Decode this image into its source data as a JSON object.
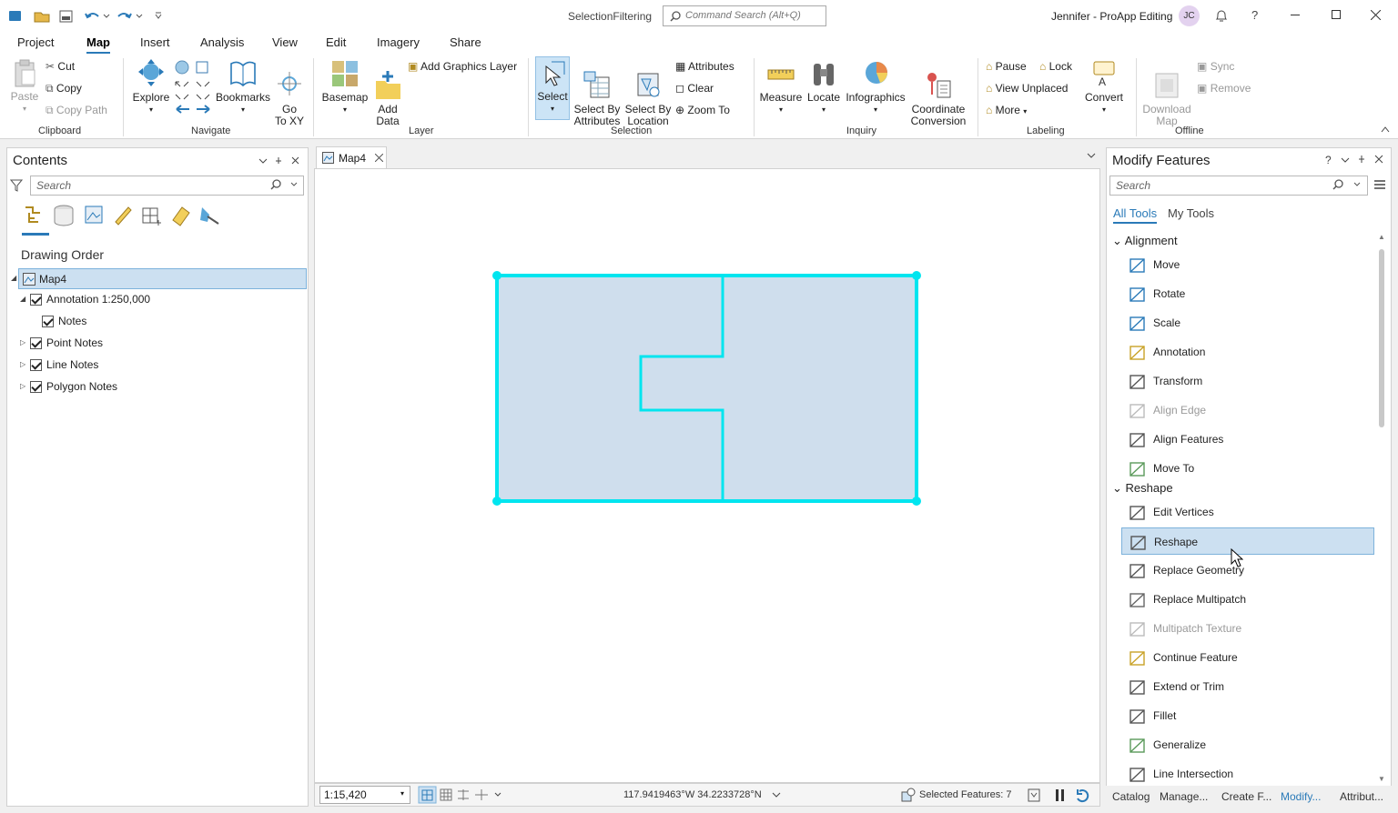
{
  "app": {
    "document_title": "SelectionFiltering",
    "user": "Jennifer - ProApp Editing",
    "avatar_initials": "JC",
    "command_search_placeholder": "Command Search (Alt+Q)"
  },
  "ribbon_tabs": [
    "Project",
    "Map",
    "Insert",
    "Analysis",
    "View",
    "Edit",
    "Imagery",
    "Share"
  ],
  "active_tab": "Map",
  "ribbon": {
    "clipboard": {
      "group": "Clipboard",
      "paste": "Paste",
      "cut": "Cut",
      "copy": "Copy",
      "copy_path": "Copy Path"
    },
    "navigate": {
      "group": "Navigate",
      "explore": "Explore",
      "bookmarks": "Bookmarks",
      "go_to_xy": "Go\nTo XY"
    },
    "layer": {
      "group": "Layer",
      "basemap": "Basemap",
      "add_data": "Add\nData",
      "add_graphics_layer": "Add Graphics Layer"
    },
    "selection": {
      "group": "Selection",
      "select": "Select",
      "select_by_attributes": "Select By\nAttributes",
      "select_by_location": "Select By\nLocation",
      "attributes": "Attributes",
      "clear": "Clear",
      "zoom_to": "Zoom To"
    },
    "inquiry": {
      "group": "Inquiry",
      "measure": "Measure",
      "locate": "Locate",
      "infographics": "Infographics",
      "coordinate_conversion": "Coordinate\nConversion"
    },
    "labeling": {
      "group": "Labeling",
      "pause": "Pause",
      "lock": "Lock",
      "view_unplaced": "View Unplaced",
      "more": "More",
      "convert": "Convert"
    },
    "offline": {
      "group": "Offline",
      "download_map": "Download\nMap",
      "sync": "Sync",
      "remove": "Remove"
    }
  },
  "contents": {
    "title": "Contents",
    "search_placeholder": "Search",
    "drawing_order": "Drawing Order",
    "map_name": "Map4",
    "layers": [
      {
        "label": "Annotation 1:250,000",
        "indent": 0,
        "expanded": true
      },
      {
        "label": "Notes",
        "indent": 1
      },
      {
        "label": "Point Notes",
        "indent": 0
      },
      {
        "label": "Line Notes",
        "indent": 0
      },
      {
        "label": "Polygon Notes",
        "indent": 0
      }
    ]
  },
  "map_view": {
    "tab_label": "Map4",
    "scale": "1:15,420",
    "coordinates": "117.9419463°W 34.2233728°N",
    "selected_features": "Selected Features: 7"
  },
  "modify": {
    "title": "Modify Features",
    "search_placeholder": "Search",
    "tabs": [
      "All Tools",
      "My Tools"
    ],
    "sections": [
      {
        "name": "Alignment",
        "tools": [
          {
            "label": "Move"
          },
          {
            "label": "Rotate"
          },
          {
            "label": "Scale"
          },
          {
            "label": "Annotation"
          },
          {
            "label": "Transform"
          },
          {
            "label": "Align Edge",
            "disabled": true
          },
          {
            "label": "Align Features"
          },
          {
            "label": "Move To"
          }
        ]
      },
      {
        "name": "Reshape",
        "tools": [
          {
            "label": "Edit Vertices"
          },
          {
            "label": "Reshape",
            "selected": true
          },
          {
            "label": "Replace Geometry"
          },
          {
            "label": "Replace Multipatch"
          },
          {
            "label": "Multipatch Texture",
            "disabled": true
          },
          {
            "label": "Continue Feature"
          },
          {
            "label": "Extend or Trim"
          },
          {
            "label": "Fillet"
          },
          {
            "label": "Generalize"
          },
          {
            "label": "Line Intersection"
          }
        ]
      }
    ]
  },
  "bottom_tabs": [
    "Catalog",
    "Manage...",
    "Create F...",
    "Modify...",
    "Attribut..."
  ],
  "active_bottom_tab": "Modify...",
  "colors": {
    "accent": "#2a7ab8",
    "selection": "#00e5ef",
    "polygon_fill": "#cfdeed"
  }
}
